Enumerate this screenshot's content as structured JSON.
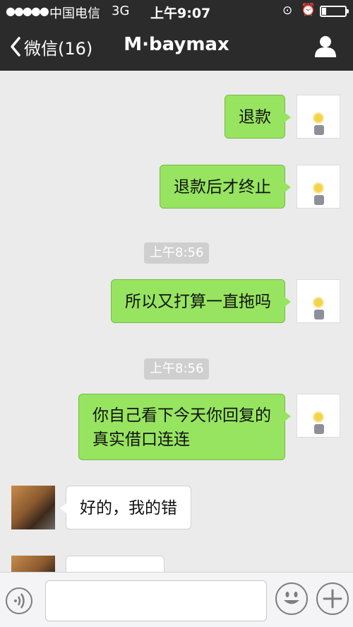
{
  "status_bar": {
    "signal": "●●●●●",
    "carrier": "中国电信",
    "network": "3G",
    "time": "上午9:07",
    "rotation_lock_glyph": "⊙",
    "alarm_glyph": "⏰",
    "battery_level": 0.2
  },
  "nav": {
    "back_label": "微信(16)",
    "title": "M·baymax"
  },
  "messages": [
    {
      "from": "me",
      "text": "退款"
    },
    {
      "from": "me",
      "text": "退款后才终止"
    },
    {
      "timestamp": "上午8:56"
    },
    {
      "from": "me",
      "text": "所以又打算一直拖吗"
    },
    {
      "timestamp": "上午8:56"
    },
    {
      "from": "me",
      "lines": [
        "你自己看下今天你回复的",
        "真实借口连连"
      ]
    },
    {
      "from": "them",
      "text": "好的，我的错"
    },
    {
      "from": "them",
      "text": ""
    }
  ],
  "colors": {
    "header_bg": "#2b2b2b",
    "chat_bg": "#ebebeb",
    "my_bubble": "#97e460",
    "their_bubble": "#ffffff",
    "timestamp_bg": "#cfcfcf"
  },
  "icons": {
    "back": "chevron-left-icon",
    "profile": "person-icon",
    "voice": "voice-icon",
    "emoji": "smiley-icon",
    "more": "plus-icon"
  }
}
